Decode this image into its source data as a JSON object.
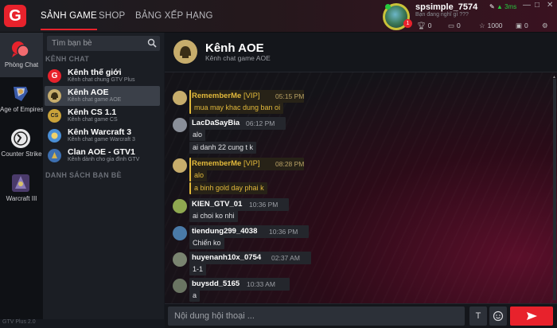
{
  "topbar": {
    "logo_letter": "G",
    "nav": [
      "SẢNH GAME",
      "SHOP",
      "BẢNG XẾP HẠNG"
    ],
    "window_controls": [
      "—",
      "□",
      "✕"
    ],
    "user": {
      "name": "spsimple_7574",
      "status": "Bạn đang nghĩ gì ???",
      "ping": "3ms",
      "level_badge": "1",
      "stats": {
        "trophies": "0",
        "messages": "0",
        "stars": "1000",
        "gifts": "0"
      }
    }
  },
  "rail": [
    {
      "label": "Phòng Chat",
      "icon": "chat-bubbles-icon",
      "active": true
    },
    {
      "label": "Age of Empires",
      "icon": "age-of-empires-icon",
      "active": false
    },
    {
      "label": "Counter Strike",
      "icon": "counter-strike-icon",
      "active": false
    },
    {
      "label": "Warcraft III",
      "icon": "warcraft-iii-icon",
      "active": false
    }
  ],
  "channels": {
    "search_placeholder": "Tìm bạn bè",
    "section_channels": "KÊNH CHAT",
    "section_friends": "DANH SÁCH BẠN BÈ",
    "items": [
      {
        "name": "Kênh thế giới",
        "desc": "Kênh chat chung GTV Plus",
        "active": false,
        "color": "#e8222c"
      },
      {
        "name": "Kênh AOE",
        "desc": "Kênh chat game AOE",
        "active": true,
        "color": "#c7ad6c"
      },
      {
        "name": "Kênh CS 1.1",
        "desc": "Kênh chat game CS",
        "active": false,
        "color": "#c9a23a"
      },
      {
        "name": "Kênh Warcraft 3",
        "desc": "Kênh chat game Warcraft 3",
        "active": false,
        "color": "#4a8fd6"
      },
      {
        "name": "Clan AOE - GTV1",
        "desc": "Kênh dành cho gia đình GTV",
        "active": false,
        "color": "#3d6fb0"
      }
    ]
  },
  "chat": {
    "title": "Kênh AOE",
    "subtitle": "Kênh chat game AOE",
    "messages": [
      {
        "user": "RememberMe",
        "tag": "[VIP]",
        "time": "05:15 PM",
        "lines": [
          "mua may khac dung ban oi"
        ]
      },
      {
        "user": "LacDaSayBia",
        "tag": "",
        "time": "06:12 PM",
        "lines": [
          "alo",
          "ai danh 22 cung t k"
        ]
      },
      {
        "user": "RememberMe",
        "tag": "[VIP]",
        "time": "08:28 PM",
        "lines": [
          "alo",
          "a binh gold day phai k"
        ]
      },
      {
        "user": "KIEN_GTV_01",
        "tag": "",
        "time": "10:36 PM",
        "lines": [
          "ai choi ko nhi"
        ]
      },
      {
        "user": "tiendung299_4038",
        "tag": "",
        "time": "10:36 PM",
        "lines": [
          "Chiến ko"
        ]
      },
      {
        "user": "huyenanh10x_0754",
        "tag": "",
        "time": "02:37 AM",
        "lines": [
          "1-1"
        ]
      },
      {
        "user": "buysdd_5165",
        "tag": "",
        "time": "10:33 AM",
        "lines": [
          "a"
        ]
      }
    ],
    "input_placeholder": "Nội dung hội thoại ...",
    "text_format_label": "T"
  },
  "version": "GTV Plus 2.0",
  "colors": {
    "accent": "#e8222c",
    "vip": "#e2b93b",
    "online": "#27c93f"
  }
}
